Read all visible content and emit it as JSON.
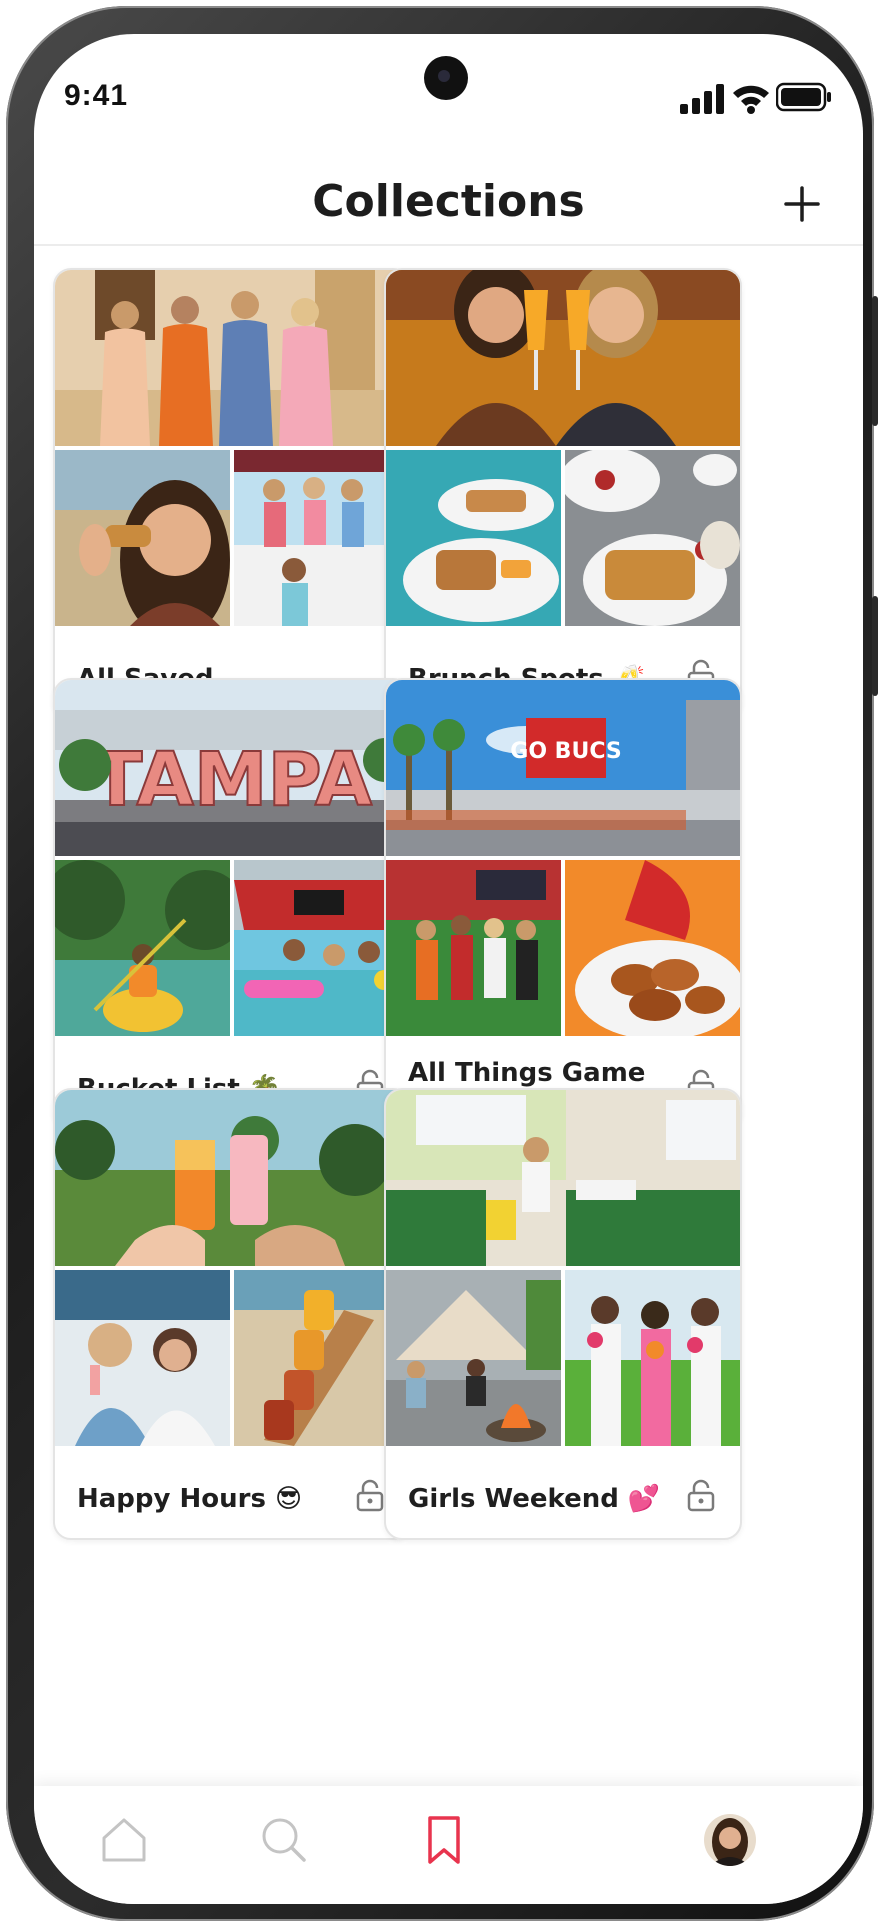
{
  "status_bar": {
    "time": "9:41"
  },
  "header": {
    "title": "Collections"
  },
  "collections": [
    {
      "label": "All Saved",
      "locked": false
    },
    {
      "label": "Brunch Spots 🥂",
      "locked": true
    },
    {
      "label": "Bucket List 🌴",
      "locked": true
    },
    {
      "label": "All Things Game Day 🏈",
      "locked": true
    },
    {
      "label": "Happy Hours 😎",
      "locked": true
    },
    {
      "label": "Girls Weekend 💕",
      "locked": true
    }
  ],
  "photo_banners": {
    "tampa_sign": "TAMPA",
    "bucs_sign": "GO BUCS"
  },
  "tab_bar": {
    "items": [
      "home-icon",
      "search-icon",
      "bookmark-icon",
      "profile-avatar"
    ],
    "active": "bookmark-icon",
    "active_color": "#e8344e",
    "inactive_color": "#c4c4c4"
  }
}
